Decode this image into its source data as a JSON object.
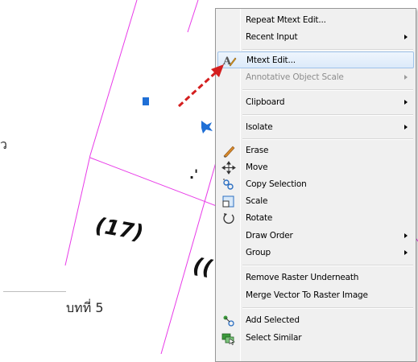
{
  "page": {
    "caption": "บทที่ 5",
    "left_fragment": "ว"
  },
  "drawing": {
    "text_marks": [
      "(17)",
      "((",
      ".'",
      "("
    ],
    "line_color": "#e83ae8",
    "arrow_color": "#d41f1f",
    "grip_color": "#1f6fd6"
  },
  "menu": {
    "items": [
      {
        "label": "Repeat Mtext Edit...",
        "icon": "",
        "submenu": false,
        "disabled": false
      },
      {
        "label": "Recent Input",
        "icon": "",
        "submenu": true,
        "disabled": false
      },
      {
        "label": "Mtext Edit...",
        "icon": "mtext-edit-icon",
        "submenu": false,
        "disabled": false,
        "highlight": true
      },
      {
        "label": "Annotative Object Scale",
        "icon": "",
        "submenu": true,
        "disabled": true
      },
      {
        "label": "Clipboard",
        "icon": "",
        "submenu": true,
        "disabled": false
      },
      {
        "label": "Isolate",
        "icon": "",
        "submenu": true,
        "disabled": false
      },
      {
        "label": "Erase",
        "icon": "eraser-icon",
        "submenu": false,
        "disabled": false
      },
      {
        "label": "Move",
        "icon": "move-icon",
        "submenu": false,
        "disabled": false
      },
      {
        "label": "Copy Selection",
        "icon": "copy-icon",
        "submenu": false,
        "disabled": false
      },
      {
        "label": "Scale",
        "icon": "scale-icon",
        "submenu": false,
        "disabled": false
      },
      {
        "label": "Rotate",
        "icon": "rotate-icon",
        "submenu": false,
        "disabled": false
      },
      {
        "label": "Draw Order",
        "icon": "",
        "submenu": true,
        "disabled": false
      },
      {
        "label": "Group",
        "icon": "",
        "submenu": true,
        "disabled": false
      },
      {
        "label": "Remove Raster Underneath",
        "icon": "",
        "submenu": false,
        "disabled": false
      },
      {
        "label": "Merge Vector To Raster Image",
        "icon": "",
        "submenu": false,
        "disabled": false
      },
      {
        "label": "Add Selected",
        "icon": "add-selected-icon",
        "submenu": false,
        "disabled": false
      },
      {
        "label": "Select Similar",
        "icon": "select-similar-icon",
        "submenu": false,
        "disabled": false
      }
    ]
  }
}
